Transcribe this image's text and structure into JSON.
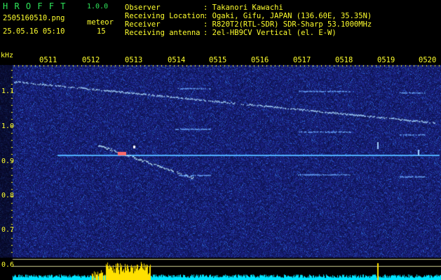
{
  "header": {
    "logo": "H R O F F T",
    "version": "1.0.0",
    "filename": "2505160510.png",
    "meteor_label": "meteor",
    "datetime": "25.05.16 05:10",
    "meteor_count": "15",
    "observer_label": "Observer",
    "observer_value": ": Takanori Kawachi",
    "location_label": "Receiving Location",
    "location_value": ": Ogaki, Gifu, JAPAN (136.60E, 35.35N)",
    "receiver_label": "Receiver",
    "receiver_value": ": R820T2(RTL-SDR) SDR-Sharp 53.1000MHz",
    "antenna_label": "Receiving antenna",
    "antenna_value": ": 2el-HB9CV Vertical (el. E-W)"
  },
  "axis": {
    "unit": "kHz",
    "time_ticks": [
      "0511",
      "0512",
      "0513",
      "0514",
      "0515",
      "0516",
      "0517",
      "0518",
      "0519",
      "0520"
    ],
    "freq_ticks": [
      "1.1",
      "1.0",
      "0.9",
      "0.8",
      "0.7",
      "0.6"
    ]
  },
  "colors": {
    "background": "#000000",
    "spectrogram_noise": "#1a2690",
    "signal": "#8cc8ff",
    "carrier": "#3aa0ff",
    "header_green": "#2ee65a",
    "header_yellow": "#ffff2e",
    "level_bars": "#00e5ff",
    "level_peak": "#ffe000"
  }
}
